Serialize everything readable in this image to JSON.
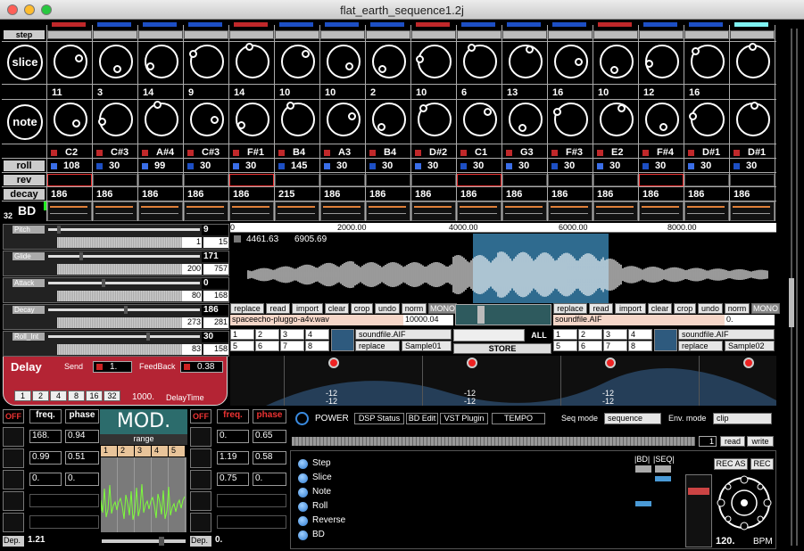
{
  "window": {
    "title": "flat_earth_sequence1.2j"
  },
  "rows": {
    "step": "step",
    "slice": "slice",
    "note": "note",
    "roll": "roll",
    "rev": "rev",
    "decay": "decay",
    "bd": "BD",
    "count": "32"
  },
  "slice_values": [
    "11",
    "3",
    "14",
    "9",
    "14",
    "10",
    "10",
    "2",
    "10",
    "6",
    "13",
    "16",
    "10",
    "12",
    "16"
  ],
  "notes": [
    "C2",
    "C#3",
    "A#4",
    "C#3",
    "F#1",
    "B4",
    "A3",
    "B4",
    "D#2",
    "C1",
    "G3",
    "F#3",
    "E2",
    "F#4",
    "D#1",
    "D#1"
  ],
  "rolls": [
    "108",
    "30",
    "99",
    "30",
    "30",
    "145",
    "30",
    "30",
    "30",
    "30",
    "30",
    "30",
    "30",
    "30",
    "30",
    "30"
  ],
  "decays": [
    "186",
    "186",
    "186",
    "186",
    "186",
    "215",
    "186",
    "186",
    "186",
    "186",
    "186",
    "186",
    "186",
    "186",
    "186",
    "186"
  ],
  "params": [
    {
      "name": "Pitch",
      "value": "9",
      "lo": "1",
      "hi": "15"
    },
    {
      "name": "Glide",
      "value": "171",
      "lo": "200",
      "hi": "757"
    },
    {
      "name": "Attack",
      "value": "0",
      "lo": "80",
      "hi": "168"
    },
    {
      "name": "Decay",
      "value": "186",
      "lo": "273",
      "hi": "281"
    },
    {
      "name": "Roll_Int",
      "value": "30",
      "lo": "83",
      "hi": "158"
    }
  ],
  "waveform": {
    "ticks": [
      "0",
      "2000.00",
      "4000.00",
      "6000.00",
      "8000.00"
    ],
    "sel_start": "4461.63",
    "sel_end": "6905.69"
  },
  "edit_buttons": [
    "replace",
    "read",
    "import",
    "clear",
    "crop",
    "undo",
    "norm",
    "MONO"
  ],
  "left_file": {
    "name": "spaceecho-pluggo-a4v.wav",
    "length": "10000.04",
    "soundfile": "soundfile.AIF",
    "mode": "replace",
    "sample": "Sample01"
  },
  "right_file": {
    "name": "soundfile.AIF",
    "length": "0.",
    "soundfile": "soundfile.AIF",
    "mode": "replace",
    "sample": "Sample02"
  },
  "pad_nums": [
    "1",
    "2",
    "3",
    "4",
    "5",
    "6",
    "7",
    "8"
  ],
  "store_label": "STORE",
  "all_label": "ALL",
  "delay": {
    "title": "Delay",
    "send_label": "Send",
    "send_value": "1.",
    "feedback_label": "FeedBack",
    "feedback_value": "0.38",
    "divs": [
      "1",
      "2",
      "4",
      "8",
      "16",
      "32"
    ],
    "time": "1000.",
    "time_label": "DelayTime"
  },
  "eq_labels": [
    "-12",
    "-12",
    "-12",
    "-12",
    "-12",
    "-12"
  ],
  "mod": {
    "off": "OFF",
    "freq": "freq.",
    "phase": "phase",
    "title": "MOD.",
    "range": "range",
    "range_nums": [
      "1",
      "2",
      "3",
      "4",
      "5"
    ],
    "left": {
      "rows": [
        [
          "168.",
          "0.94"
        ],
        [
          "0.99",
          "0.51"
        ],
        [
          "0.",
          "0."
        ]
      ],
      "dep_label": "Dep.",
      "dep": "1.21"
    },
    "right": {
      "rows": [
        [
          "0.",
          "0.65"
        ],
        [
          "1.19",
          "0.58"
        ],
        [
          "0.75",
          "0."
        ]
      ],
      "dep_label": "Dep.",
      "dep": "0."
    }
  },
  "power": {
    "label": "POWER",
    "tabs": [
      "DSP Status",
      "BD Edit",
      "VST Plugin",
      "TEMPO"
    ],
    "seq_mode_label": "Seq mode",
    "seq_mode": "sequence",
    "env_mode_label": "Env. mode",
    "env_mode": "clip",
    "step_num": "1",
    "read": "read",
    "write": "write"
  },
  "routing": [
    "Step",
    "Slice",
    "Note",
    "Roll",
    "Reverse",
    "BD"
  ],
  "bd_seq": {
    "bd": "|BD|",
    "seq": "|SEQ|",
    "rec_as": "REC AS",
    "rec": "REC",
    "bpm": "120.",
    "bpm_label": "BPM"
  },
  "colors": {
    "step_red": "#c0282a",
    "step_blue": "#1d4fc4",
    "step_cyan": "#7ff2f2",
    "delay_bg": "#b42434",
    "wave_sel": "#2f6b8f",
    "accent_orange": "#e0803a"
  }
}
